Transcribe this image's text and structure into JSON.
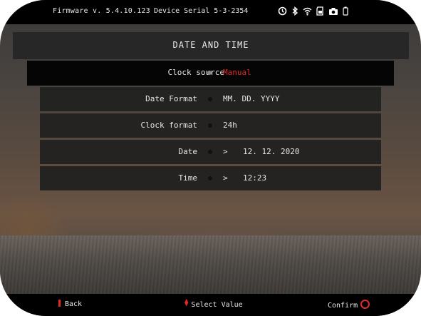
{
  "status_bar": {
    "firmware": "Firmware v. 5.4.10.123",
    "serial": "Device Serial 5-3-2354",
    "icons": [
      "timer-icon",
      "bluetooth-icon",
      "wifi-icon",
      "sd-card-icon",
      "camera-icon",
      "battery-icon"
    ]
  },
  "header": {
    "title": "DATE AND TIME"
  },
  "settings": [
    {
      "label": "Clock source",
      "value": "Manual",
      "selected": true
    },
    {
      "label": "Date Format",
      "value": "MM. DD. YYYY"
    },
    {
      "label": "Clock format",
      "value": "24h"
    },
    {
      "label": "Date",
      "value": "12. 12. 2020",
      "arrow": ">"
    },
    {
      "label": "Time",
      "value": "12:23",
      "arrow": ">"
    }
  ],
  "footer": {
    "back_label": "Back",
    "select_label": "Select Value",
    "confirm_label": "Confirm"
  },
  "colors": {
    "accent_red": "#e02a2a",
    "panel_bg": "#202020",
    "selected_bg": "#050505",
    "text": "#e6e6e6"
  }
}
